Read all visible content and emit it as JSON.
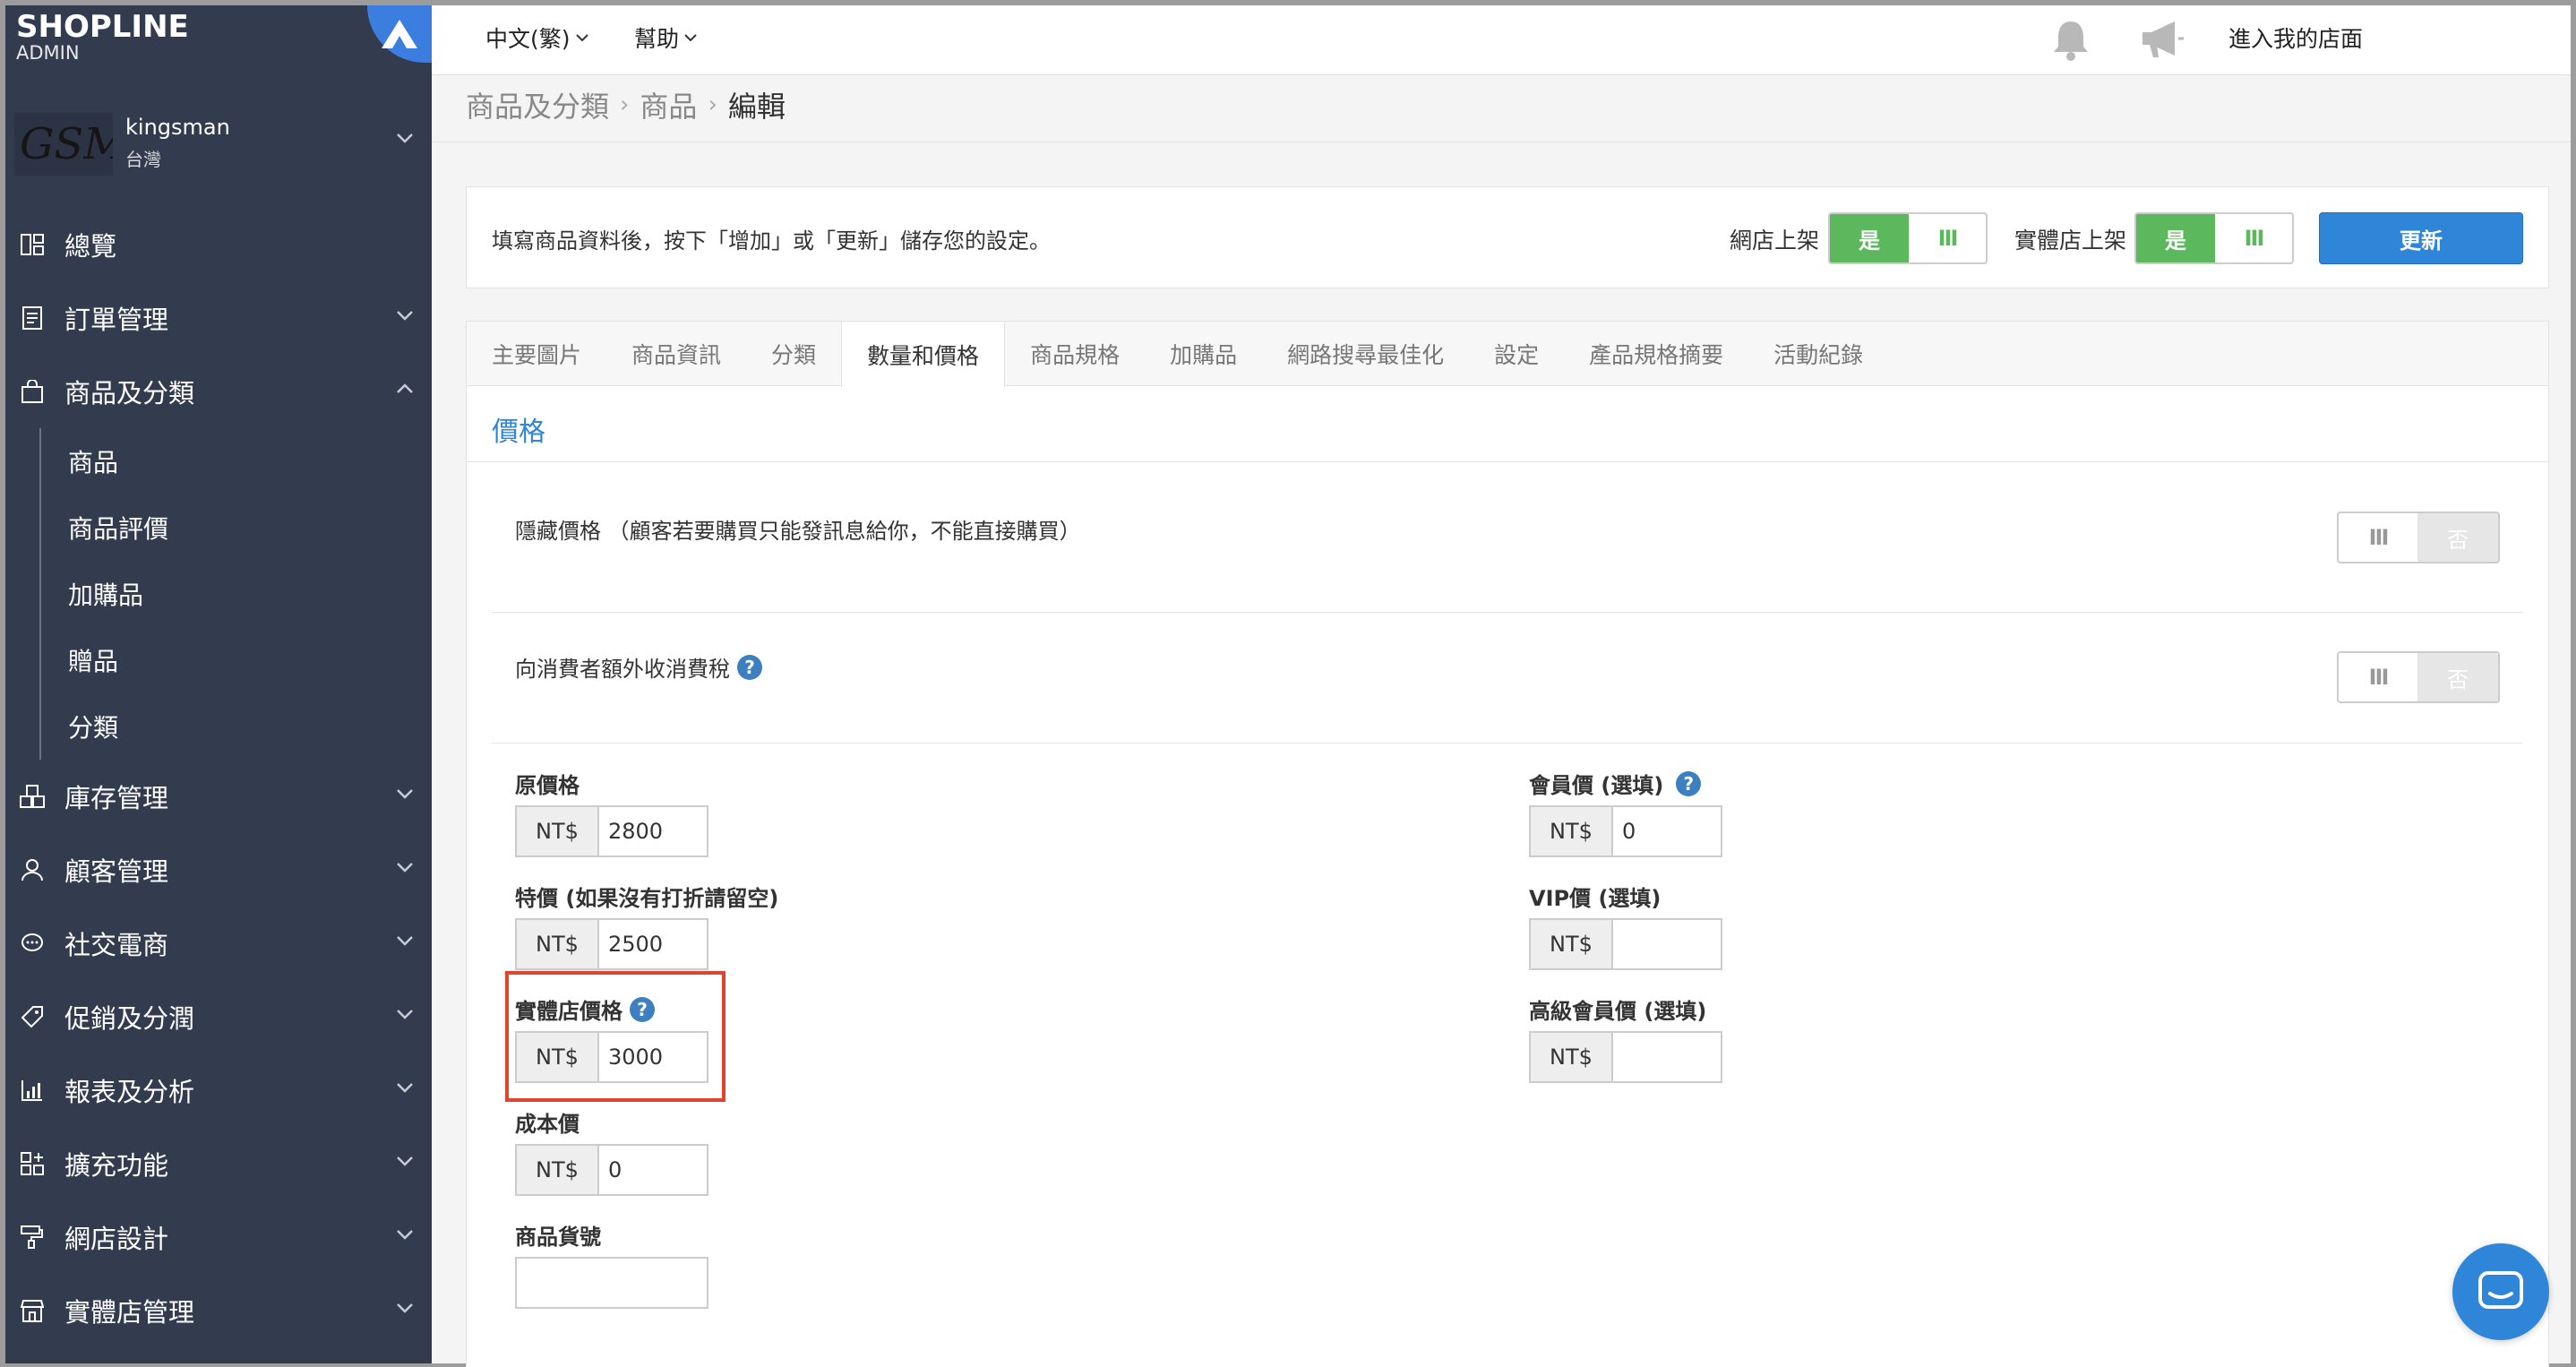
{
  "brand": {
    "name": "SHOPLINE",
    "sub": "ADMIN"
  },
  "account": {
    "logo_text": "GSM",
    "name": "kingsman",
    "region": "台灣"
  },
  "sidebar": {
    "items": [
      {
        "label": "總覽",
        "icon": "dashboard-icon",
        "expandable": false
      },
      {
        "label": "訂單管理",
        "icon": "order-icon",
        "expandable": true
      },
      {
        "label": "商品及分類",
        "icon": "bag-icon",
        "expandable": true,
        "expanded": true
      },
      {
        "label": "庫存管理",
        "icon": "inventory-icon",
        "expandable": true
      },
      {
        "label": "顧客管理",
        "icon": "customer-icon",
        "expandable": true
      },
      {
        "label": "社交電商",
        "icon": "chat-bubble-icon",
        "expandable": true
      },
      {
        "label": "促銷及分潤",
        "icon": "tag-icon",
        "expandable": true
      },
      {
        "label": "報表及分析",
        "icon": "report-icon",
        "expandable": true
      },
      {
        "label": "擴充功能",
        "icon": "apps-icon",
        "expandable": true
      },
      {
        "label": "網店設計",
        "icon": "paint-roller-icon",
        "expandable": true
      },
      {
        "label": "實體店管理",
        "icon": "store-icon",
        "expandable": true
      }
    ],
    "sub_items": [
      "商品",
      "商品評價",
      "加購品",
      "贈品",
      "分類"
    ]
  },
  "topbar": {
    "language": "中文(繁)",
    "help": "幫助",
    "store_link": "進入我的店面"
  },
  "breadcrumb": {
    "level1": "商品及分類",
    "level2": "商品",
    "current": "編輯"
  },
  "infobar": {
    "text": "填寫商品資料後，按下「增加」或「更新」儲存您的設定。",
    "online_label": "網店上架",
    "retail_label": "實體店上架",
    "yes": "是",
    "bars": "III",
    "update": "更新"
  },
  "tabs": [
    "主要圖片",
    "商品資訊",
    "分類",
    "數量和價格",
    "商品規格",
    "加購品",
    "網路搜尋最佳化",
    "設定",
    "產品規格摘要",
    "活動紀錄"
  ],
  "active_tab": "數量和價格",
  "section_title": "價格",
  "hide_price": {
    "label": "隱藏價格 （顧客若要購買只能發訊息給你，不能直接購買）",
    "bars": "III",
    "no": "否"
  },
  "tax": {
    "label": "向消費者額外收消費稅",
    "bars": "III",
    "no": "否"
  },
  "help_glyph": "?",
  "currency": "NT$",
  "fields": {
    "original": {
      "label": "原價格",
      "value": "2800"
    },
    "sale": {
      "label": "特價 (如果沒有打折請留空)",
      "value": "2500"
    },
    "retail": {
      "label": "實體店價格",
      "value": "3000"
    },
    "cost": {
      "label": "成本價",
      "value": "0"
    },
    "sku": {
      "label": "商品貨號",
      "value": ""
    },
    "member": {
      "label": "會員價 (選填)",
      "value": "0"
    },
    "vip": {
      "label": "VIP價 (選填)",
      "value": ""
    },
    "premium": {
      "label": "高級會員價 (選填)",
      "value": ""
    }
  }
}
